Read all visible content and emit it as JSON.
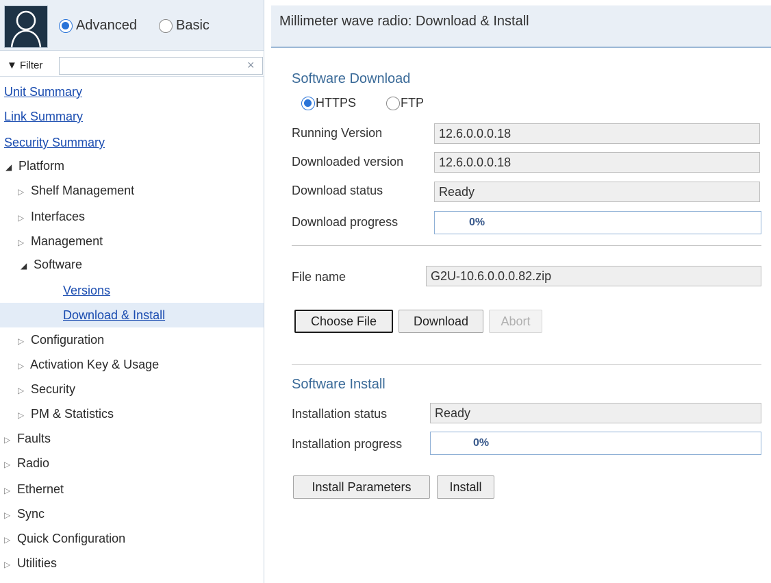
{
  "sidebar": {
    "mode_advanced": "Advanced",
    "mode_basic": "Basic",
    "filter_label": "▼ Filter",
    "filter_value": "",
    "filter_clear": "×",
    "tree": [
      {
        "label": "Unit Summary",
        "type": "link",
        "arrow": ""
      },
      {
        "label": "Link Summary",
        "type": "link",
        "arrow": ""
      },
      {
        "label": "Security Summary",
        "type": "link",
        "arrow": ""
      },
      {
        "label": "Platform",
        "type": "node",
        "arrow": "◢"
      },
      {
        "label": "Shelf Management",
        "type": "node",
        "arrow": "▷"
      },
      {
        "label": "Interfaces",
        "type": "node",
        "arrow": "▷"
      },
      {
        "label": "Management",
        "type": "node",
        "arrow": "▷"
      },
      {
        "label": "Software",
        "type": "node",
        "arrow": "◢"
      },
      {
        "label": "Versions",
        "type": "link",
        "arrow": ""
      },
      {
        "label": "Download & Install",
        "type": "link",
        "arrow": "",
        "selected": true
      },
      {
        "label": "Configuration",
        "type": "node",
        "arrow": "▷"
      },
      {
        "label": "Activation Key & Usage",
        "type": "node",
        "arrow": "▷"
      },
      {
        "label": "Security",
        "type": "node",
        "arrow": "▷"
      },
      {
        "label": "PM & Statistics",
        "type": "node",
        "arrow": "▷"
      },
      {
        "label": "Faults",
        "type": "node",
        "arrow": "▷"
      },
      {
        "label": "Radio",
        "type": "node",
        "arrow": "▷"
      },
      {
        "label": "Ethernet",
        "type": "node",
        "arrow": "▷"
      },
      {
        "label": "Sync",
        "type": "node",
        "arrow": "▷"
      },
      {
        "label": "Quick Configuration",
        "type": "node",
        "arrow": "▷"
      },
      {
        "label": "Utilities",
        "type": "node",
        "arrow": "▷"
      }
    ]
  },
  "main": {
    "title": "Millimeter wave radio: Download & Install",
    "download": {
      "section_title": "Software Download",
      "protocol_https": "HTTPS",
      "protocol_ftp": "FTP",
      "running_version_label": "Running Version",
      "running_version_value": "12.6.0.0.0.18",
      "downloaded_version_label": "Downloaded version",
      "downloaded_version_value": "12.6.0.0.0.18",
      "status_label": "Download status",
      "status_value": "Ready",
      "progress_label": "Download progress",
      "progress_text": "0%",
      "progress_fraction": 0,
      "file_name_label": "File name",
      "file_name_value": "G2U-10.6.0.0.0.82.zip",
      "choose_file_label": "Choose File",
      "download_label": "Download",
      "abort_label": "Abort"
    },
    "install": {
      "section_title": "Software Install",
      "status_label": "Installation status",
      "status_value": "Ready",
      "progress_label": "Installation progress",
      "progress_text": "0%",
      "progress_fraction": 0,
      "install_parameters_label": "Install Parameters",
      "install_label": "Install"
    }
  }
}
